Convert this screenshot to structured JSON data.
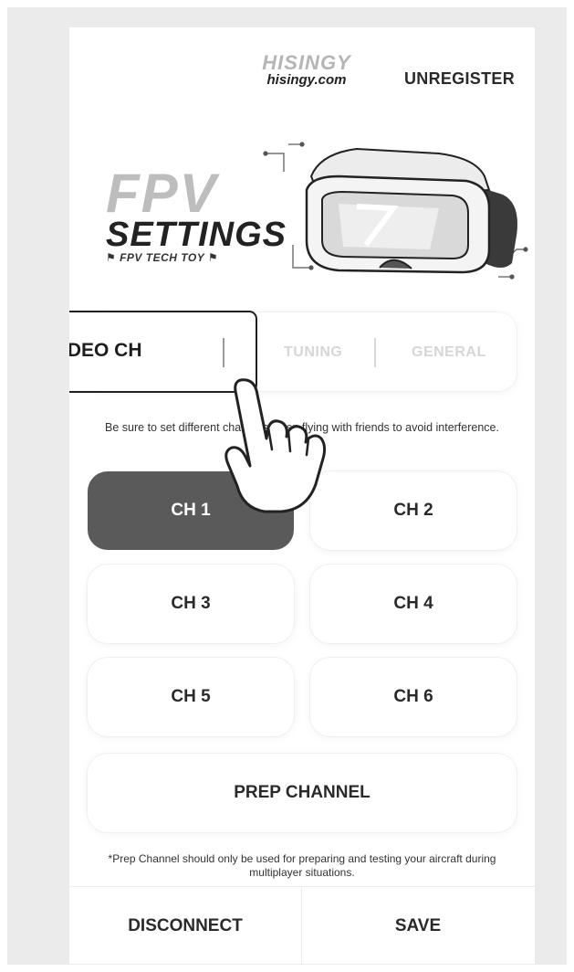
{
  "header": {
    "logo_mark": "HISINGY",
    "logo_url": "hisingy.com",
    "unregister_label": "UNREGISTER"
  },
  "hero": {
    "title_line1": "FPV",
    "title_line2": "SETTINGS",
    "subtitle": "FPV TECH TOY"
  },
  "tabs": [
    {
      "label": "VIDEO CH",
      "active": true
    },
    {
      "label": "TUNING",
      "active": false
    },
    {
      "label": "GENERAL",
      "active": false
    }
  ],
  "notice": "Be sure to set different channels when flying with friends to avoid interference.",
  "channels": [
    {
      "label": "CH 1",
      "selected": true
    },
    {
      "label": "CH 2",
      "selected": false
    },
    {
      "label": "CH 3",
      "selected": false
    },
    {
      "label": "CH 4",
      "selected": false
    },
    {
      "label": "CH 5",
      "selected": false
    },
    {
      "label": "CH 6",
      "selected": false
    }
  ],
  "prep_channel_label": "PREP CHANNEL",
  "footnote": "*Prep Channel should only be used for preparing and testing your aircraft during multiplayer situations.",
  "footer": {
    "disconnect_label": "DISCONNECT",
    "save_label": "SAVE"
  },
  "colors": {
    "selected_channel": "#5a5a5a",
    "inactive_tab_text": "#d6d6d6",
    "background": "#ebebeb"
  },
  "icons": [
    "goggles-illustration",
    "pointing-hand-icon"
  ]
}
